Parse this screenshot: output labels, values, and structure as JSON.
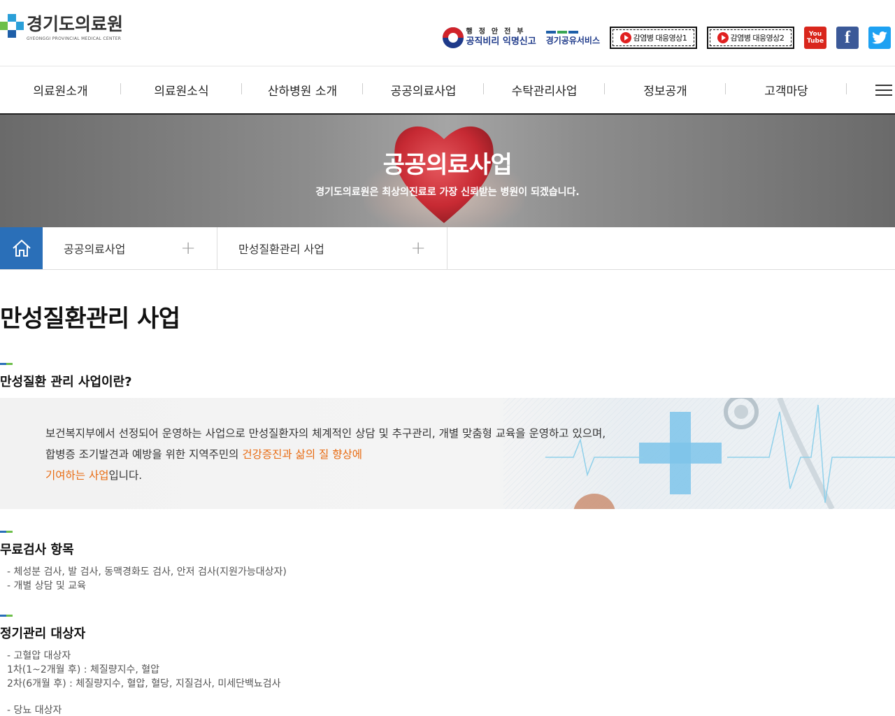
{
  "header": {
    "logo_ko": "경기도의료원",
    "logo_en": "GYEONGGI PROVINCIAL MEDICAL CENTER",
    "mois_top": "행정안전부",
    "mois_bottom": "공직비리 익명신고",
    "share_label": "경기공유서비스",
    "video1_label": "감염병 대응영상1",
    "video2_label": "감염병 대응영상2",
    "youtube_line1": "You",
    "youtube_line2": "Tube",
    "facebook_glyph": "f",
    "twitter_glyph": "🐦"
  },
  "gnb": {
    "items": [
      {
        "label": "의료원소개"
      },
      {
        "label": "의료원소식"
      },
      {
        "label": "산하병원 소개"
      },
      {
        "label": "공공의료사업"
      },
      {
        "label": "수탁관리사업"
      },
      {
        "label": "정보공개"
      },
      {
        "label": "고객마당"
      }
    ]
  },
  "visual": {
    "title": "공공의료사업",
    "subtitle": "경기도의료원은 최상의진료로 가장 신뢰받는 병원이 되겠습니다."
  },
  "location": {
    "depth1": "공공의료사업",
    "depth2": "만성질환관리 사업",
    "plus": "+"
  },
  "content": {
    "page_title": "만성질환관리 사업",
    "section1": {
      "title": "만성질환 관리 사업이란?",
      "line1": "보건복지부에서 선정되어 운영하는 사업으로 만성질환자의 체계적인 상담 및 추구관리, 개별 맞춤형 교육을 운영하고 있으며,",
      "line2_plain": "합병증 조기발견과 예방을 위한 지역주민의 ",
      "line2_highlight": "건강증진과 삶의 질 향상에",
      "line3_highlight": "기여하는 사업",
      "line3_plain": "입니다."
    },
    "section2": {
      "title": "무료검사 항목",
      "items": [
        "- 체성분 검사, 발 검사, 동맥경화도 검사, 안저 검사(지원가능대상자)",
        "- 개별 상담 및 교육"
      ]
    },
    "section3": {
      "title": "정기관리 대상자",
      "items": [
        "- 고혈압 대상자",
        "1차(1~2개월 후) : 체질량지수, 혈압",
        "2차(6개월 후) : 체질량지수, 혈압, 혈당, 지질검사, 미세단백뇨검사",
        "- 당뇨 대상자"
      ]
    }
  },
  "colors": {
    "primary_blue": "#2a6fb8",
    "accent_green": "#6dbf4a",
    "highlight_orange": "#e86a10"
  }
}
